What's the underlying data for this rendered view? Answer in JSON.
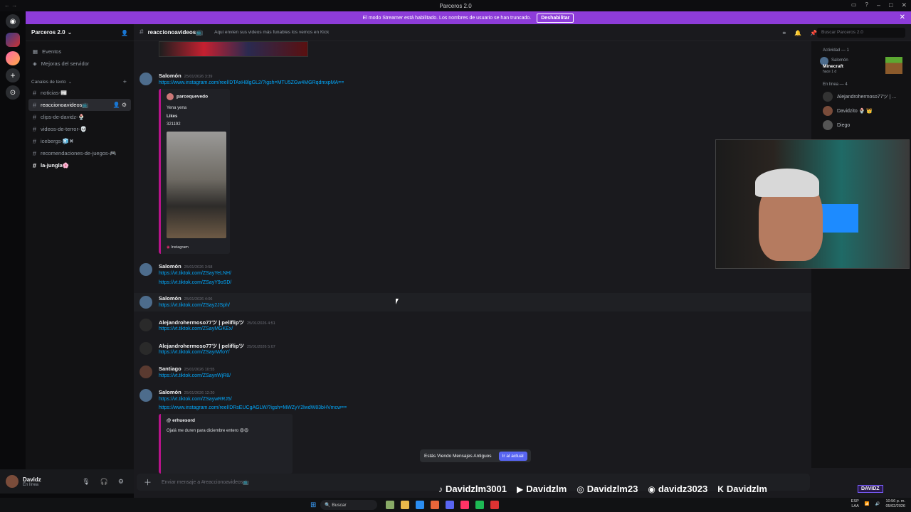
{
  "window": {
    "title": "Parceros 2.0"
  },
  "banner": {
    "text": "El modo Streamer está habilitado. Los nombres de usuario se han truncado.",
    "button": "Deshabilitar"
  },
  "server": {
    "name": "Parceros 2.0"
  },
  "nav": {
    "events": "Eventos",
    "improve": "Mejoras del servidor"
  },
  "category": {
    "label": "Canales de texto"
  },
  "channels": [
    {
      "label": "noticias-📰"
    },
    {
      "label": "reaccionoavideos📺"
    },
    {
      "label": "clips-de-davidz-🍨"
    },
    {
      "label": "videos-de-terror-💀"
    },
    {
      "label": "icebergs-🧊✖"
    },
    {
      "label": "recomendaciones-de-juegos-🎮"
    },
    {
      "label": "la-jungla🌸"
    }
  ],
  "user": {
    "name": "Davidz",
    "status": "En línea"
  },
  "header": {
    "channel": "reaccionoavideos📺",
    "topic": "Aqui envien sus videos más funables los vemos en Kick",
    "search_placeholder": "Buscar Parceros 2.0"
  },
  "messages": [
    {
      "author": "Salomón",
      "time": "25/01/2026 3:39",
      "links": [
        "https://www.instagram.com/reel/DTAxH8lgGL2/?igsh=MTU5ZGw4MGRqdmxpMA=="
      ]
    },
    {
      "author": "Salomón",
      "time": "25/01/2026 3:58",
      "links": [
        "https://vt.tiktok.com/ZSayYeLNH/",
        "https://vt.tiktok.com/ZSayY9oSD/"
      ]
    },
    {
      "author": "Salomón",
      "time": "25/01/2026 4:06",
      "links": [
        "https://vt.tiktok.com/ZSay2JSph/"
      ]
    },
    {
      "author": "Alejandrohermoso77ツ | peliflipツ",
      "time": "25/01/2026 4:51",
      "links": [
        "https://vt.tiktok.com/ZSayMGKEx/"
      ]
    },
    {
      "author": "Alejandrohermoso77ツ | peliflipツ",
      "time": "25/01/2026 5:07",
      "links": [
        "https://vt.tiktok.com/ZSayrWfoY/"
      ]
    },
    {
      "author": "Santiago",
      "time": "25/01/2026 10:55",
      "links": [
        "https://vt.tiktok.com/ZSaynWjR8/"
      ]
    },
    {
      "author": "Salomón",
      "time": "25/01/2026 12:20",
      "links": [
        "https://vt.tiktok.com/ZSaywRRJ5/",
        "https://www.instagram.com/reel/DRsEUCgAGLW/?igsh=MWZyY2lwdW83bHVmcw=="
      ]
    }
  ],
  "embed1": {
    "author": "parcequevedo",
    "line1": "Yena yena",
    "line2": "Likes",
    "line3": "321192",
    "footer": "Instagram"
  },
  "embed2": {
    "author": "erhuesord",
    "text": "Ojalá me duren para diciembre entero 😩😩"
  },
  "members": {
    "activity_header": "Actividad — 1",
    "activity_user": "Salomón",
    "activity_game": "Minecraft",
    "activity_time": "hace 1 d",
    "online_header": "En línea — 4",
    "online": [
      "Alejandrohermoso77ツ | ...",
      "Davidzito 🍨 👑",
      "Diego"
    ]
  },
  "notice": {
    "text": "Estás Viendo Mensajes Antiguos",
    "button": "Ir al actual"
  },
  "composer": {
    "placeholder": "Enviar mensaje a #reaccionoavideos📺"
  },
  "socials": [
    {
      "icon": "tiktok-icon",
      "label": "Davidzlm3001"
    },
    {
      "icon": "youtube-icon",
      "label": "Davidzlm"
    },
    {
      "icon": "instagram-icon",
      "label": "Davidzlm23"
    },
    {
      "icon": "discord-icon",
      "label": "davidz3023"
    },
    {
      "icon": "kick-icon",
      "label": "Davidzlm"
    }
  ],
  "overlay_badge": "DAVIDZ",
  "taskbar": {
    "search": "Buscar",
    "lang1": "ESP",
    "lang2": "LAA",
    "time": "10:56 p. m.",
    "date": "05/02/2026"
  },
  "colors": {
    "accent": "#8d3cd9",
    "link": "#00a8fc",
    "blurple": "#5865f2",
    "embed_border": "#b8138a"
  }
}
